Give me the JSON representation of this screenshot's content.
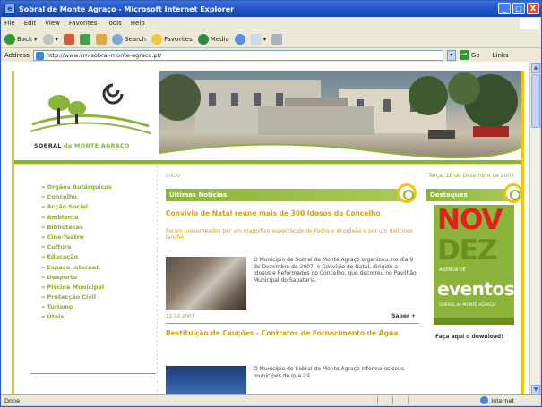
{
  "window": {
    "title": "Sobral de Monte Agraço - Microsoft Internet Explorer",
    "controls": {
      "min": "_",
      "max": "□",
      "close": "X"
    }
  },
  "menubar": [
    "File",
    "Edit",
    "View",
    "Favorites",
    "Tools",
    "Help"
  ],
  "toolbar": {
    "back": "Back",
    "search": "Search",
    "favorites": "Favorites",
    "media": "Media"
  },
  "addressbar": {
    "label": "Address",
    "url": "http://www.cm-sobral-monte-agraco.pt/",
    "go": "Go",
    "links": "Links"
  },
  "site": {
    "logo_text_1": "SOBRAL",
    "logo_text_2": " de MONTE AGRAÇO",
    "breadcrumb": "Início",
    "date": "Terça, 18 de Dezembro de 2007",
    "nav": [
      "Orgãos Autárquicos",
      "Concelho",
      "Acção Social",
      "Ambiente",
      "Bibliotecas",
      "Cine-Teatro",
      "Cultura",
      "Educação",
      "Espaço Internet",
      "Desporto",
      "Piscina Municipal",
      "Protecção Civil",
      "Turismo",
      "Úteis"
    ],
    "news_section": "Últimas Notícias",
    "news": [
      {
        "title": "Convívio de Natal reúne mais de 300 idosos do Concelho",
        "lead": "Foram presenteados por um magnífico espectáculo de Fados e Acordeão e por um delicioso lanche.",
        "body": "O Município de Sobral de Monte Agraço organizou, no dia 9 de Dezembro de 2007, o Convívio de Natal, dirigido a Idosos e Reformados do Concelho, que decorreu no Pavilhão Municipal do Sapataria.",
        "date": "12-12-2007",
        "more": "Saber +"
      },
      {
        "title": "Restituição de Cauções - Contratos de Fornecimento de Água",
        "body": "O Município de Sobral de Monte Agraço informa os seus munícipes de que irá..."
      }
    ],
    "highlights_section": "Destaques",
    "promo": {
      "month1": "NOV",
      "month2": "DEZ",
      "agenda": "AGENDA DE",
      "eventos": "eventos",
      "mini": "SOBRAL de MONTE AGRAÇO"
    },
    "download": "Faça aqui o download!"
  },
  "status": {
    "text": "Done",
    "zone": "Internet"
  },
  "colors": {
    "brand_green": "#8cb43c",
    "brand_yellow": "#f1c40f",
    "news_title": "#d3a10c",
    "promo_red": "#e0231a"
  }
}
